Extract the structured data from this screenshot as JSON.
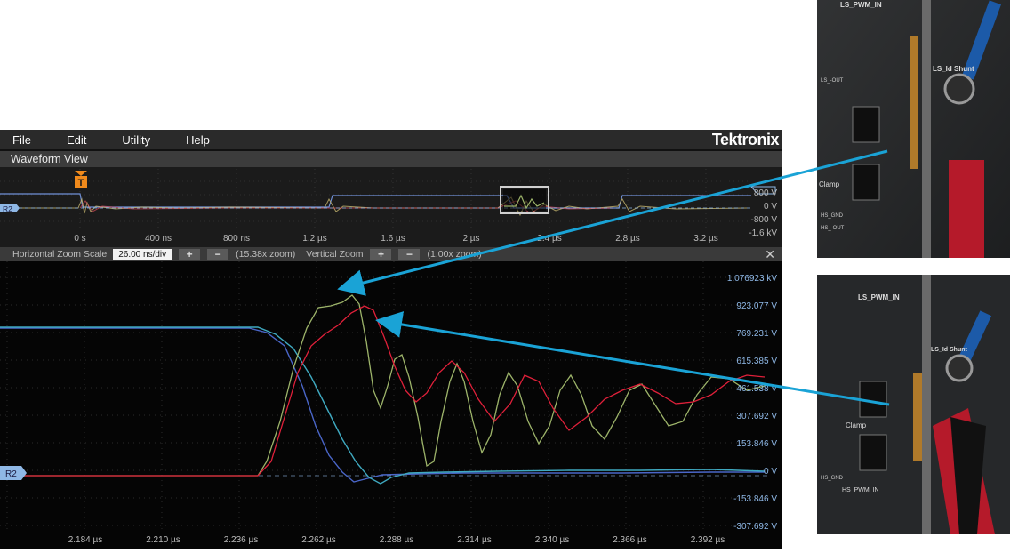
{
  "menubar": {
    "items": [
      "File",
      "Edit",
      "Utility",
      "Help"
    ],
    "brand": "Tektronix"
  },
  "waveform_view": {
    "title": "Waveform View"
  },
  "overview": {
    "x_labels": [
      "0 s",
      "400 ns",
      "800 ns",
      "1.2 µs",
      "1.6 µs",
      "2 µs",
      "2.4 µs",
      "2.8 µs",
      "3.2 µs"
    ],
    "y_labels": [
      "800 V",
      "0 V",
      "-800 V",
      "-1.6 kV"
    ],
    "trigger_marker": "T",
    "ref_marker": "R2"
  },
  "zoom_bar": {
    "horizontal_label": "Horizontal Zoom Scale",
    "horizontal_value": "26.00 ns/div",
    "plus": "+",
    "minus": "−",
    "horizontal_zoom": "(15.38x zoom)",
    "vertical_label": "Vertical Zoom",
    "vertical_zoom": "(1.00x zoom)",
    "close": "✕"
  },
  "main_plot": {
    "ref_marker": "R2",
    "y_labels": [
      "1.076923 kV",
      "923.077 V",
      "769.231 V",
      "615.385 V",
      "461.538 V",
      "307.692 V",
      "153.846 V",
      "0 V",
      "-153.846 V",
      "-307.692 V"
    ],
    "x_labels": [
      "2.184 µs",
      "2.210 µs",
      "2.236 µs",
      "2.262 µs",
      "2.288 µs",
      "2.314 µs",
      "2.340 µs",
      "2.366 µs",
      "2.392 µs"
    ]
  },
  "colors": {
    "ch_blue": "#4a66c8",
    "ch_cyan": "#3fa9c0",
    "ch_yellow": "#9db46a",
    "ch_red": "#e0203a",
    "arrow": "#1aa3d6",
    "trigger": "#f08a1c",
    "ref_marker": "#8fb8e6"
  },
  "photos": {
    "top": {
      "labels": [
        "LS_PWM_IN",
        "LS_Id Shunt",
        "Clamp",
        "LS_-OUT",
        "HS_GND",
        "HS_-OUT"
      ]
    },
    "bottom": {
      "labels": [
        "LS_PWM_IN",
        "LS_Id Shunt",
        "Clamp",
        "HS_PWM_IN",
        "HS_GND"
      ]
    }
  }
}
